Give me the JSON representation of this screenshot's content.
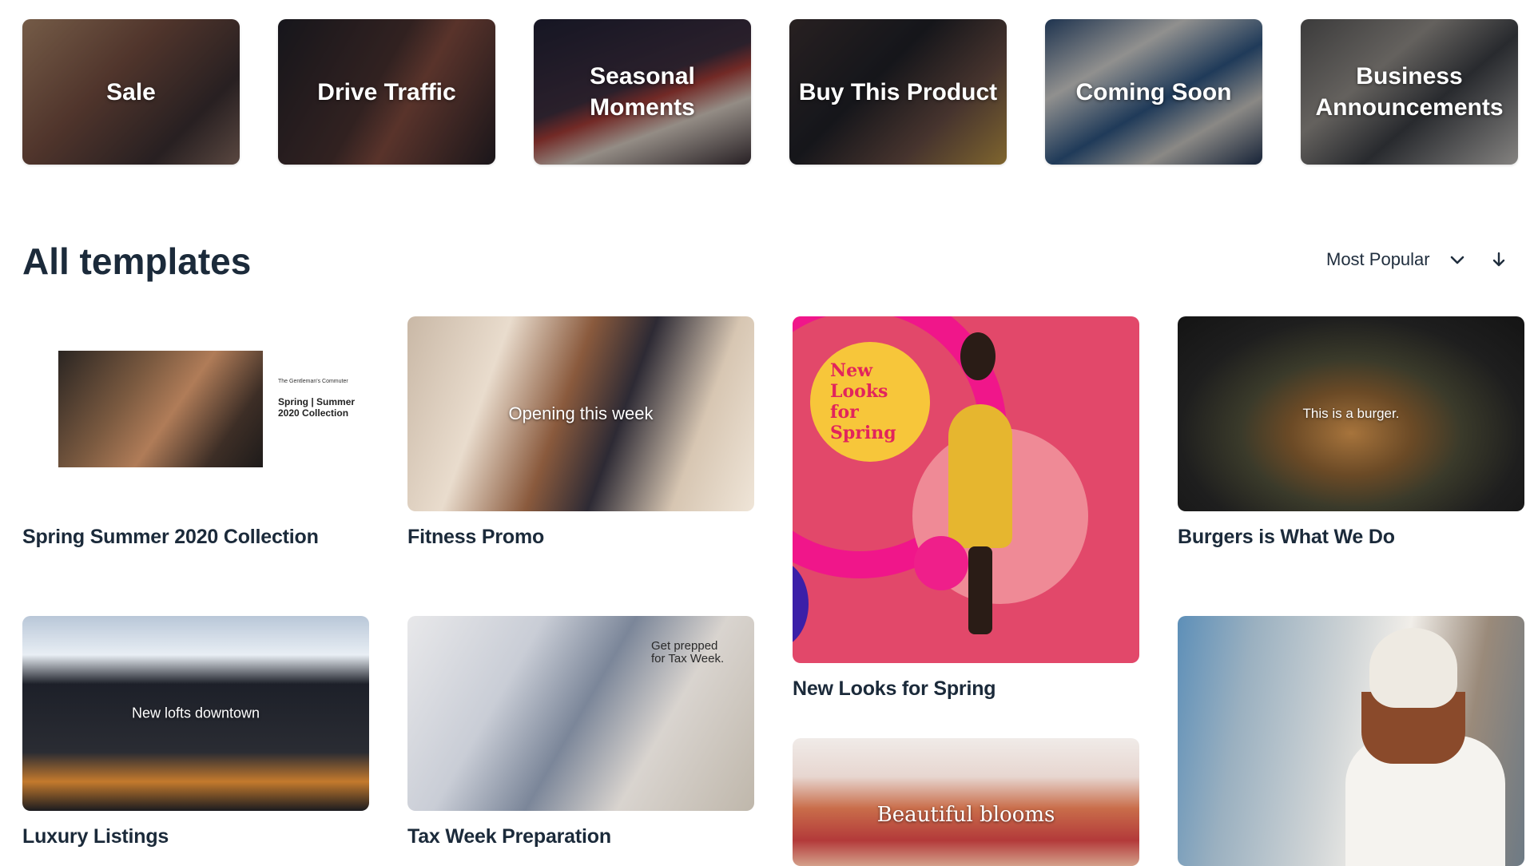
{
  "categories": [
    {
      "label": "Sale"
    },
    {
      "label": "Drive Traffic"
    },
    {
      "label": "Seasonal Moments"
    },
    {
      "label": "Buy This Product"
    },
    {
      "label": "Coming Soon"
    },
    {
      "label": "Business Announcements"
    }
  ],
  "section": {
    "title": "All templates",
    "sort": {
      "selected": "Most Popular",
      "icon": "chevron-down-icon",
      "direction_icon": "arrow-down-icon"
    }
  },
  "templates": [
    {
      "title": "Spring Summer 2020 Collection",
      "thumb_small_text": "The Gentleman's Commuter",
      "thumb_text": "Spring | Summer\n2020 Collection"
    },
    {
      "title": "Fitness Promo",
      "thumb_text": "Opening this week"
    },
    {
      "title": "New Looks for Spring",
      "thumb_text": "New\nLooks\nfor\nSpring"
    },
    {
      "title": "Burgers is What We Do",
      "thumb_text": "This is a burger."
    },
    {
      "title": "Luxury Listings",
      "thumb_text": "New lofts downtown"
    },
    {
      "title": "Tax Week Preparation",
      "thumb_text": "Get prepped\nfor Tax Week."
    },
    {
      "title": "",
      "thumb_text": "Beautiful blooms"
    },
    {
      "title": "",
      "thumb_text": ""
    }
  ]
}
